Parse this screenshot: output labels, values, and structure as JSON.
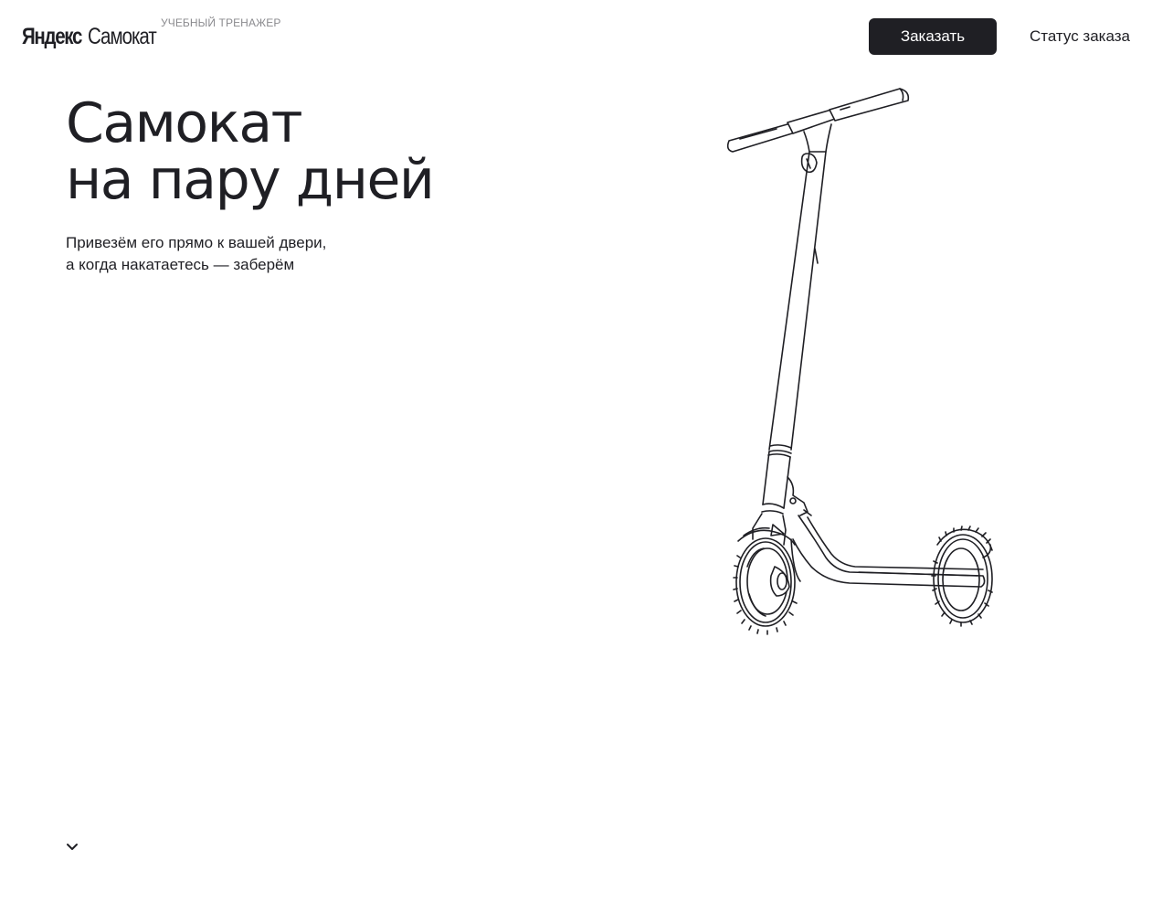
{
  "header": {
    "logo": {
      "brand": "Яндекс",
      "product": "Самокат",
      "subtitle": "УЧЕБНЫЙ ТРЕНАЖЕР"
    },
    "order_button": "Заказать",
    "status_button": "Статус заказа"
  },
  "hero": {
    "title_line1": "Самокат",
    "title_line2": "на пару дней",
    "subtitle_line1": "Привезём его прямо к вашей двери,",
    "subtitle_line2": "а когда накатаетесь — заберём"
  },
  "icons": {
    "scroll": "chevron-down-icon",
    "illustration": "scooter-illustration"
  },
  "colors": {
    "text": "#1f1f24",
    "button_bg": "#1f1f24",
    "button_text": "#ffffff",
    "muted": "#8a8a8e",
    "background": "#ffffff"
  }
}
